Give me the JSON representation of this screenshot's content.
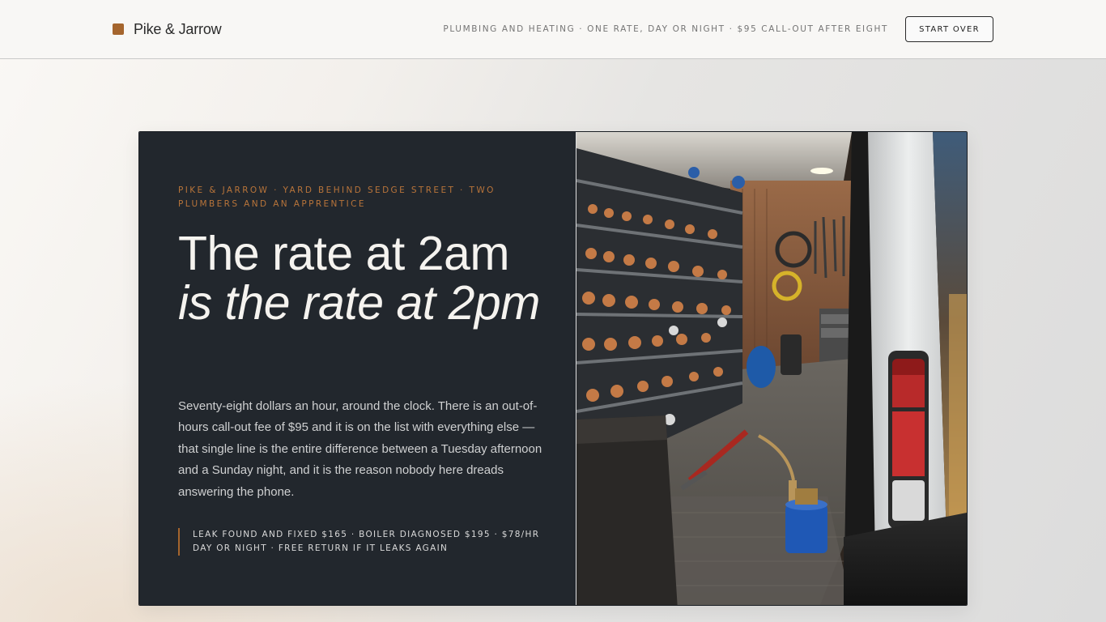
{
  "header": {
    "brand_name": "Pike & Jarrow",
    "brand_color": "#a5652d",
    "tagline": "PLUMBING AND HEATING · ONE RATE, DAY OR NIGHT · $95 CALL-OUT AFTER EIGHT",
    "start_over_label": "START OVER"
  },
  "hero": {
    "eyebrow": "PIKE & JARROW · YARD BEHIND SEDGE STREET · TWO PLUMBERS AND AN APPRENTICE",
    "headline_line1": "The rate at 2am",
    "headline_line2": "is the rate at 2pm",
    "body": "Seventy-eight dollars an hour, around the clock. There is an out-of-hours call-out fee of $95 and it is on the list with everything else — that single line is the entire difference between a Tuesday afternoon and a Sunday night, and it is the reason nobody here dreads answering the phone.",
    "pricing_note": "LEAK FOUND AND FIXED $165 · BOILER DIAGNOSED $195 · $78/HR DAY OR NIGHT · FREE RETURN IF IT LEAKS AGAIN",
    "accent_color": "#b8743a",
    "panel_color": "#22272d"
  }
}
